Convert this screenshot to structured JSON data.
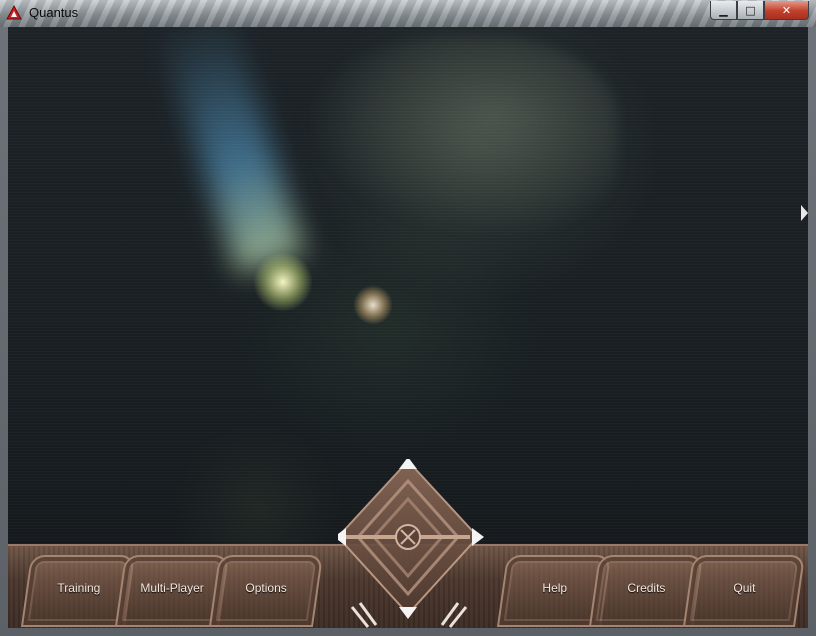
{
  "window": {
    "title": "Quantus",
    "controls": {
      "minimize": "▁",
      "maximize": "□",
      "close": "✕"
    }
  },
  "menu": {
    "items": [
      {
        "label": "Training"
      },
      {
        "label": "Multi-Player"
      },
      {
        "label": "Options"
      },
      {
        "label": "Help"
      },
      {
        "label": "Credits"
      },
      {
        "label": "Quit"
      }
    ]
  },
  "center_control": {
    "icons": [
      "arrow-up-icon",
      "arrow-down-icon",
      "arrow-left-icon",
      "arrow-right-icon",
      "center-target-icon"
    ]
  },
  "colors": {
    "console": "#4a362c",
    "console_border": "#a58470",
    "label": "#f2e8e0",
    "scene_bg": "#181e22"
  }
}
